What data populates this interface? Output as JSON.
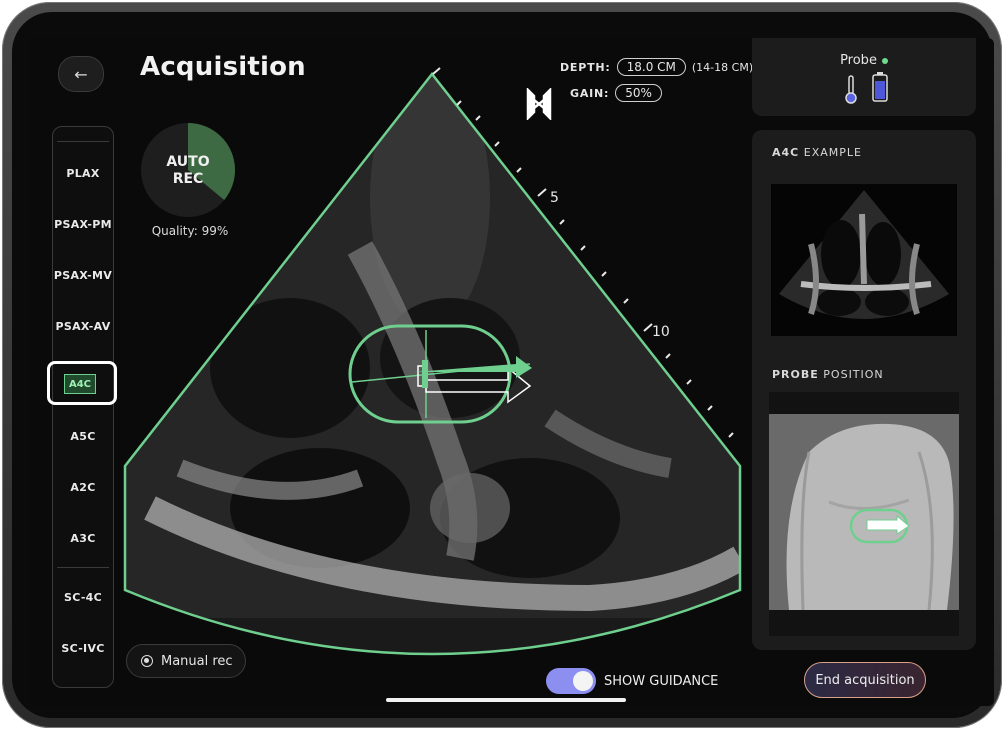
{
  "header": {
    "title": "Acquisition",
    "back_icon": "arrow-left-icon"
  },
  "settings": {
    "depth_label": "DEPTH:",
    "depth_value": "18.0 CM",
    "depth_range": "(14-18 CM)",
    "gain_label": "GAIN:",
    "gain_value": "50%"
  },
  "views": {
    "items": [
      "PLAX",
      "PSAX-PM",
      "PSAX-MV",
      "PSAX-AV",
      "A4C",
      "A5C",
      "A2C",
      "A3C",
      "SC-4C",
      "SC-IVC"
    ],
    "selected": "A4C"
  },
  "auto_rec": {
    "label_line1": "AUTO",
    "label_line2": "REC",
    "quality": "Quality: 99%",
    "progress_fraction": 0.36
  },
  "manual_rec": {
    "label": "Manual rec"
  },
  "depth_markers": [
    "5",
    "10"
  ],
  "probe": {
    "title": "Probe",
    "status_color": "#6fdc8c",
    "temperature_icon": "thermometer-icon",
    "battery_icon": "battery-icon"
  },
  "example": {
    "label_bold": "A4C",
    "label_rest": " EXAMPLE"
  },
  "probe_position": {
    "label_bold": "PROBE",
    "label_rest": " POSITION"
  },
  "guidance": {
    "label": "SHOW GUIDANCE",
    "enabled": true
  },
  "end_button": {
    "label": "End acquisition"
  },
  "colors": {
    "accent_green": "#6fcf8e",
    "toggle_on": "#8c8ff0",
    "card_bg": "#1c1c1c"
  }
}
